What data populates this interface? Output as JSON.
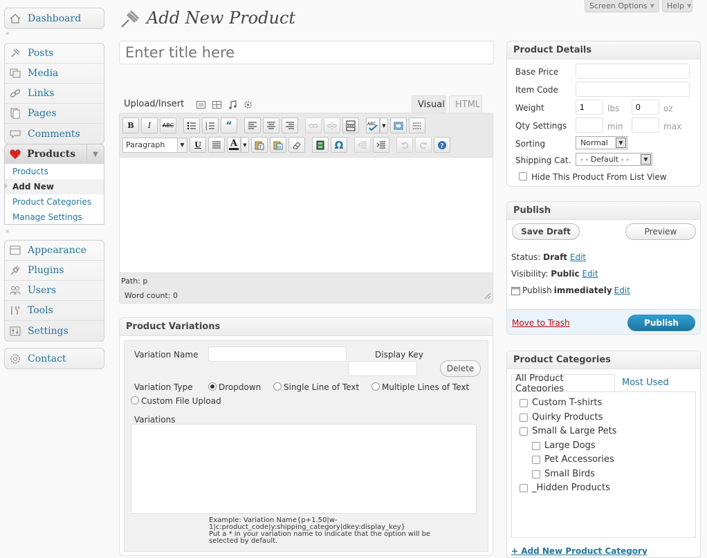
{
  "screen_options": {
    "label": "Screen Options"
  },
  "help": {
    "label": "Help"
  },
  "page": {
    "title": "Add New Product"
  },
  "title_field": {
    "placeholder": "Enter title here"
  },
  "menu": {
    "dashboard": "Dashboard",
    "posts": "Posts",
    "media": "Media",
    "links": "Links",
    "pages": "Pages",
    "comments": "Comments",
    "products": "Products",
    "submenu": [
      "Products",
      "Add New",
      "Product Categories",
      "Manage Settings"
    ],
    "appearance": "Appearance",
    "plugins": "Plugins",
    "users": "Users",
    "tools": "Tools",
    "settings": "Settings",
    "contact": "Contact"
  },
  "editor": {
    "upload_insert": "Upload/Insert",
    "tab_visual": "Visual",
    "tab_html": "HTML",
    "format_select": "Paragraph",
    "path": "Path: p",
    "word_count": "Word count: 0"
  },
  "product_details": {
    "title": "Product Details",
    "base_price": "Base Price",
    "item_code": "Item Code",
    "weight": "Weight",
    "weight_lbs": "1",
    "weight_oz": "0",
    "unit_lbs": "lbs",
    "unit_oz": "oz",
    "qty_settings": "Qty Settings",
    "unit_min": "min",
    "unit_max": "max",
    "sorting": "Sorting",
    "sorting_value": "Normal",
    "shipping_cat": "Shipping Cat.",
    "shipping_value": "- - Default - -",
    "hide_label": "Hide This Product From List View"
  },
  "publish": {
    "title": "Publish",
    "save_draft": "Save Draft",
    "preview": "Preview",
    "status_label": "Status:",
    "status_value": "Draft",
    "visibility_label": "Visibility:",
    "visibility_value": "Public",
    "publish_label": "Publish",
    "publish_value": "immediately",
    "edit": "Edit",
    "move_to_trash": "Move to Trash",
    "publish_button": "Publish"
  },
  "product_categories": {
    "title": "Product Categories",
    "tab_all": "All Product Categories",
    "tab_most_used": "Most Used",
    "items": [
      "Custom T-shirts",
      "Quirky Products",
      "Small & Large Pets",
      "Large Dogs",
      "Pet Accessories",
      "Small Birds",
      "_Hidden Products"
    ],
    "add_new": "+ Add New Product Category"
  },
  "variations": {
    "title": "Product Variations",
    "variation_name": "Variation Name",
    "display_key": "Display Key",
    "delete": "Delete",
    "variation_type": "Variation Type",
    "opt_dropdown": "Dropdown",
    "opt_single": "Single Line of Text",
    "opt_multiple": "Multiple Lines of Text",
    "opt_file": "Custom File Upload",
    "variations_label": "Variations",
    "example_line1": "Example: Variation Name{p+1.50|w-",
    "example_line2": "1|c:product_code|y:shipping_category|dkey:display_key}",
    "example_line3": "Put a * in your variation name to indicate that the option will be",
    "example_line4": "selected by default."
  }
}
